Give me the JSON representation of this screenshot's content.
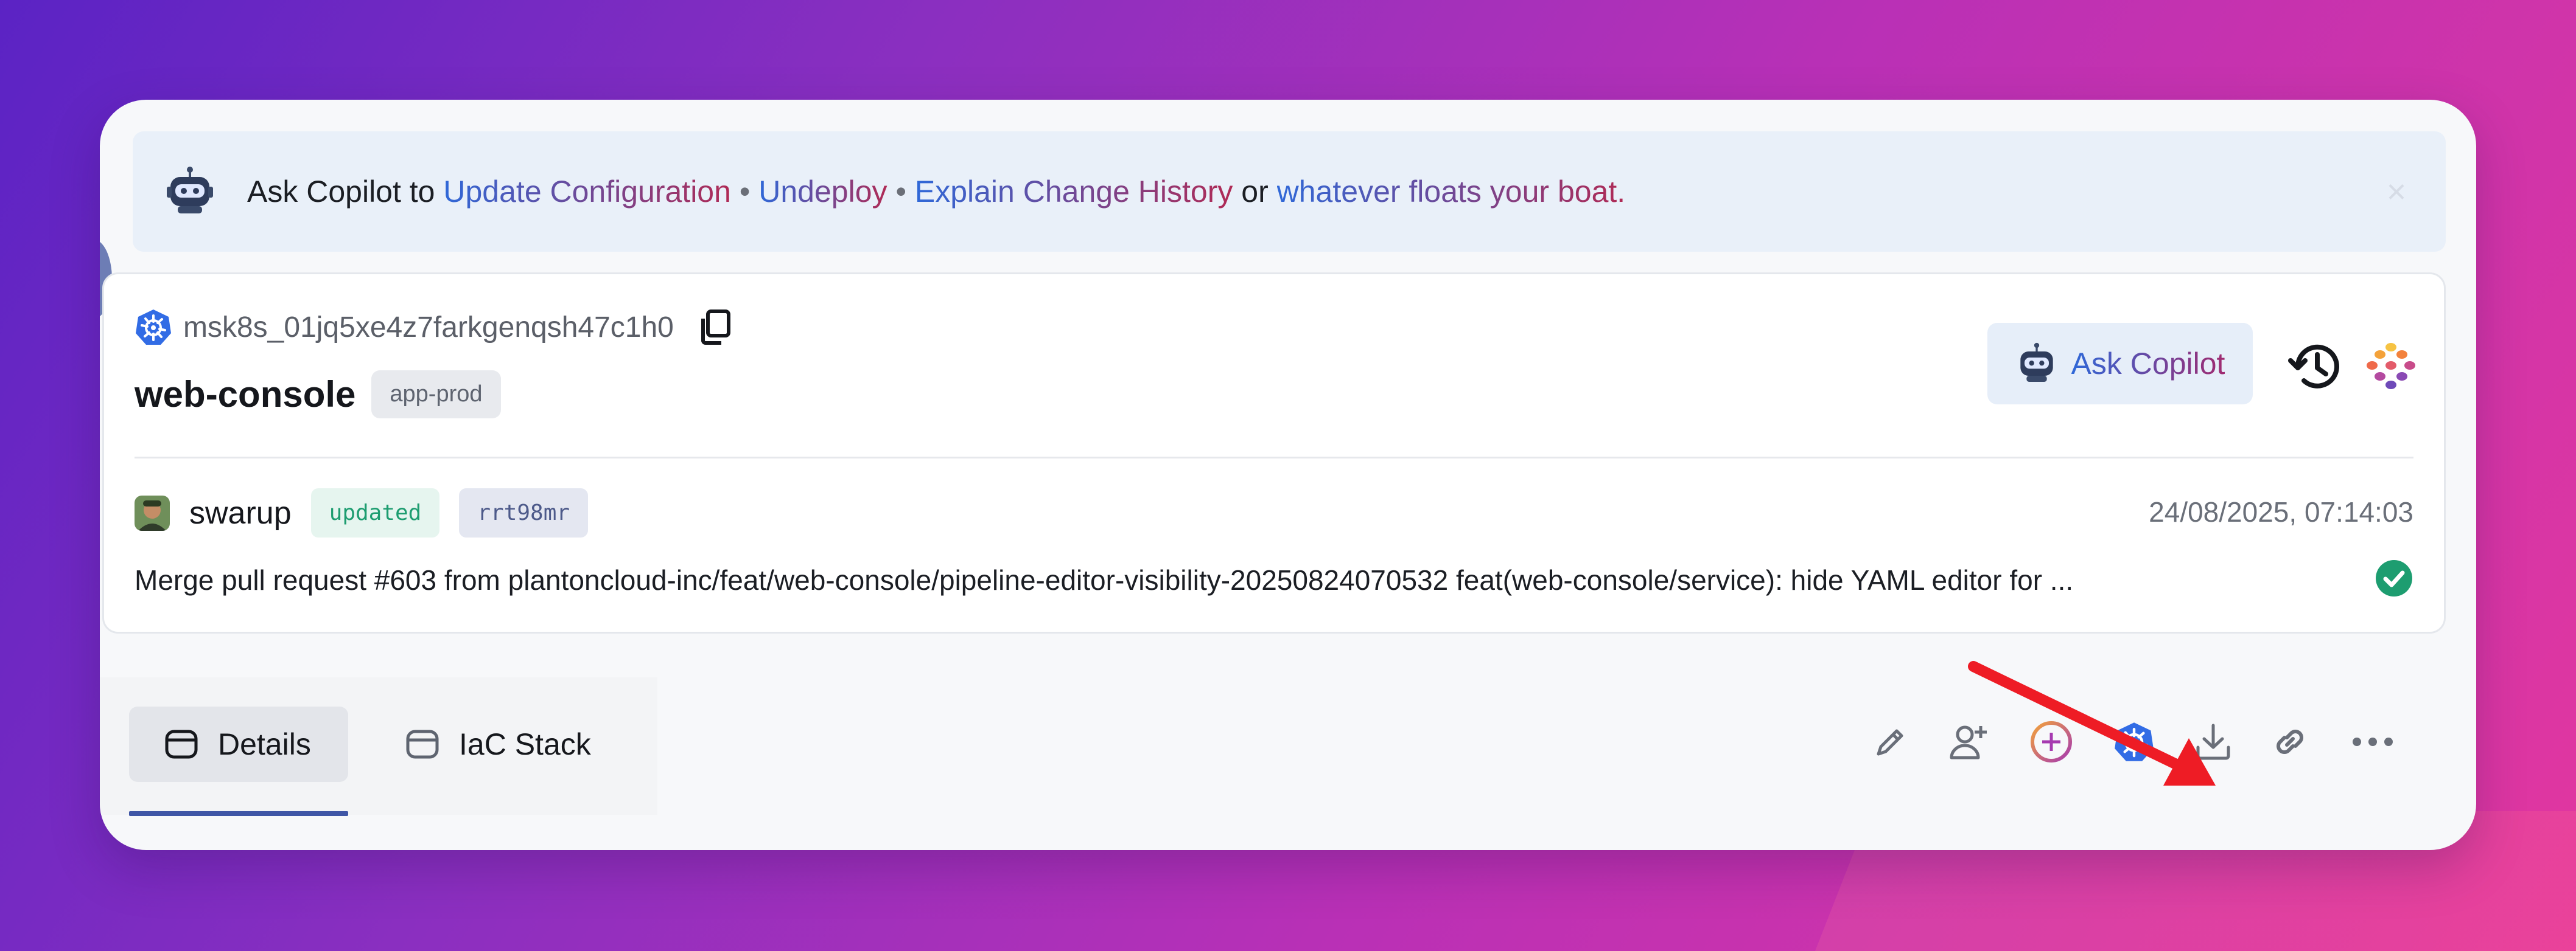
{
  "banner": {
    "prefix": "Ask Copilot to",
    "link_update": "Update Configuration",
    "sep1": "•",
    "link_undeploy": "Undeploy",
    "sep2": "•",
    "link_history": "Explain Change History",
    "connector": "or",
    "link_other": "whatever floats your boat.",
    "close_icon": "close-icon"
  },
  "resource": {
    "id": "msk8s_01jq5xe4z7farkgenqsh47c1h0",
    "name": "web-console",
    "environment": "app-prod",
    "ask_copilot_label": "Ask Copilot"
  },
  "commit": {
    "author": "swarup",
    "status": "updated",
    "hash": "rrt98mr",
    "timestamp": "24/08/2025, 07:14:03",
    "message": "Merge pull request #603 from plantoncloud-inc/feat/web-console/pipeline-editor-visibility-20250824070532 feat(web-console/service): hide YAML editor for ..."
  },
  "tabs": [
    {
      "label": "Details",
      "active": true
    },
    {
      "label": "IaC Stack",
      "active": false
    }
  ],
  "toolbar": {
    "icons": [
      "edit-icon",
      "add-user-icon",
      "add-circle-icon",
      "kubernetes-icon",
      "download-icon",
      "link-icon",
      "more-icon"
    ]
  },
  "colors": {
    "accent_blue": "#2f5fd0",
    "accent_red": "#b02a55",
    "kubernetes_blue": "#326ce5",
    "success_green": "#1d9d70",
    "annotation_arrow": "#ee1c25"
  }
}
